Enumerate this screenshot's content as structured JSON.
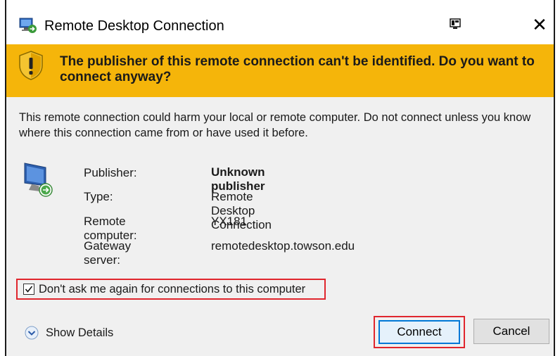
{
  "window": {
    "title": "Remote Desktop Connection",
    "close_glyph": "✕"
  },
  "banner": {
    "message": "The publisher of this remote connection can't be identified. Do you want to connect anyway?",
    "background_color": "#f5b50a"
  },
  "warning": {
    "text": "This remote connection could harm your local or remote computer. Do not connect unless you know where this connection came from or have used it before."
  },
  "details": {
    "rows": [
      {
        "label": "Publisher:",
        "value": "Unknown publisher"
      },
      {
        "label": "Type:",
        "value": "Remote Desktop Connection"
      },
      {
        "label": "Remote computer:",
        "value": "YX181"
      },
      {
        "label": "Gateway server:",
        "value": "remotedesktop.towson.edu"
      }
    ]
  },
  "options": {
    "dont_ask_label": "Don't ask me again for connections to this computer",
    "dont_ask_checked": true
  },
  "footer": {
    "show_details_label": "Show Details",
    "connect_label": "Connect",
    "cancel_label": "Cancel"
  },
  "icons": {
    "app": "remote-desktop-icon",
    "pin": "pin-icon",
    "close": "close-icon",
    "warning": "warning-shield-icon",
    "monitor": "remote-monitor-icon",
    "expand": "chevron-down-icon"
  },
  "highlight_color": "#e0262d"
}
